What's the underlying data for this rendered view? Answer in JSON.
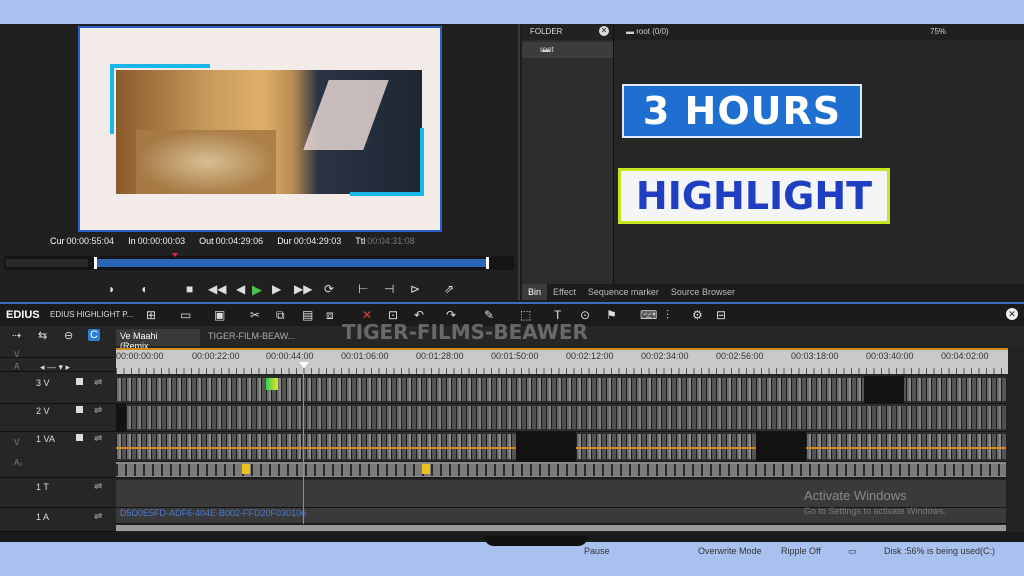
{
  "player": {
    "timecodes": [
      {
        "label": "Cur",
        "value": "00:00:55:04"
      },
      {
        "label": "In",
        "value": "00:00:00:03"
      },
      {
        "label": "Out",
        "value": "00:04:29:06"
      },
      {
        "label": "Dur",
        "value": "00:04:29:03"
      },
      {
        "label": "Ttl",
        "value": "00:04:31:08"
      }
    ]
  },
  "bin": {
    "folder_header": "FOLDER",
    "folder_item": "root",
    "main_header": "root (0/0)",
    "zoom": "75%",
    "tabs": [
      "Bin",
      "Effect",
      "Sequence marker",
      "Source Browser"
    ]
  },
  "overlay": {
    "title1": "3 HOURS",
    "title2": "HIGHLIGHT",
    "watermark": "TIGER-FILMS-BEAWER"
  },
  "timeline": {
    "logo": "EDIUS",
    "project": "EDIUS HIGHLIGHT P...",
    "sequence_tabs": [
      "Ve Maahi (Remix...",
      "TIGER-FILM-BEAW..."
    ],
    "ruler": [
      "00:00:00:00",
      "00:00:22:00",
      "00:00:44:00",
      "00:01:06:00",
      "00:01:28:00",
      "00:01:50:00",
      "00:02:12:00",
      "00:02:34:00",
      "00:02:56:00",
      "00:03:18:00",
      "00:03:40:00",
      "00:04:02:00"
    ],
    "tracks": [
      "3 V",
      "2 V",
      "1 VA",
      "1 T",
      "1 A"
    ],
    "guid": "D5D0E5FD-ADF6-404E-B002-FFD20F030106"
  },
  "status": {
    "state": "Pause",
    "mode": "Overwrite Mode",
    "ripple": "Ripple Off",
    "disk": "Disk :56% is being used(C:)"
  },
  "activate": {
    "title": "Activate Windows",
    "sub": "Go to Settings to activate Windows."
  },
  "colors": {
    "accent": "#2a66b8",
    "cursor": "#27b7d8",
    "audio": "#d08a20",
    "play": "#4bc24b"
  }
}
